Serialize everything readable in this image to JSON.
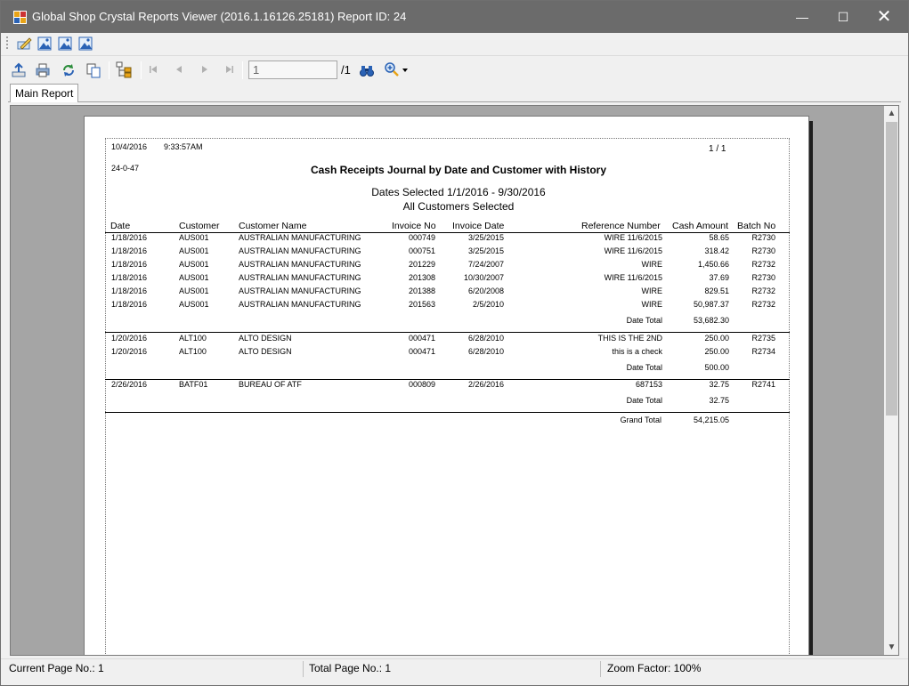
{
  "window": {
    "title": "Global Shop Crystal Reports Viewer (2016.1.16126.25181) Report ID: 24",
    "minimize": "—",
    "maximize": "☐",
    "close": "✕"
  },
  "toolbar": {
    "page_number": "1",
    "page_total": "/1"
  },
  "tabs": [
    {
      "label": "Main Report"
    }
  ],
  "report": {
    "print_date": "10/4/2016",
    "print_time": "9:33:57AM",
    "report_code": "24-0-47",
    "page_indicator": "1  /  1",
    "title": "Cash Receipts Journal by Date and Customer with History",
    "dates_selected": "Dates Selected   1/1/2016 - 9/30/2016",
    "customers_selected": "All Customers Selected",
    "columns": {
      "date": "Date",
      "customer": "Customer",
      "customer_name": "Customer Name",
      "invoice_no": "Invoice No",
      "invoice_date": "Invoice Date",
      "reference_number": "Reference Number",
      "cash_amount": "Cash Amount",
      "batch_no": "Batch No"
    },
    "groups": [
      {
        "rows": [
          {
            "date": "1/18/2016",
            "customer": "AUS001",
            "name": "AUSTRALIAN MANUFACTURING",
            "invoice": "000749",
            "inv_date": "3/25/2015",
            "ref": "WIRE 11/6/2015",
            "amount": "58.65",
            "batch": "R2730"
          },
          {
            "date": "1/18/2016",
            "customer": "AUS001",
            "name": "AUSTRALIAN MANUFACTURING",
            "invoice": "000751",
            "inv_date": "3/25/2015",
            "ref": "WIRE 11/6/2015",
            "amount": "318.42",
            "batch": "R2730"
          },
          {
            "date": "1/18/2016",
            "customer": "AUS001",
            "name": "AUSTRALIAN MANUFACTURING",
            "invoice": "201229",
            "inv_date": "7/24/2007",
            "ref": "WIRE",
            "amount": "1,450.66",
            "batch": "R2732"
          },
          {
            "date": "1/18/2016",
            "customer": "AUS001",
            "name": "AUSTRALIAN MANUFACTURING",
            "invoice": "201308",
            "inv_date": "10/30/2007",
            "ref": "WIRE 11/6/2015",
            "amount": "37.69",
            "batch": "R2730"
          },
          {
            "date": "1/18/2016",
            "customer": "AUS001",
            "name": "AUSTRALIAN MANUFACTURING",
            "invoice": "201388",
            "inv_date": "6/20/2008",
            "ref": "WIRE",
            "amount": "829.51",
            "batch": "R2732"
          },
          {
            "date": "1/18/2016",
            "customer": "AUS001",
            "name": "AUSTRALIAN MANUFACTURING",
            "invoice": "201563",
            "inv_date": "2/5/2010",
            "ref": "WIRE",
            "amount": "50,987.37",
            "batch": "R2732"
          }
        ],
        "total_label": "Date Total",
        "total": "53,682.30"
      },
      {
        "rows": [
          {
            "date": "1/20/2016",
            "customer": "ALT100",
            "name": "ALTO DESIGN",
            "invoice": "000471",
            "inv_date": "6/28/2010",
            "ref": "THIS IS THE 2ND",
            "amount": "250.00",
            "batch": "R2735"
          },
          {
            "date": "1/20/2016",
            "customer": "ALT100",
            "name": "ALTO DESIGN",
            "invoice": "000471",
            "inv_date": "6/28/2010",
            "ref": "this is a check",
            "amount": "250.00",
            "batch": "R2734"
          }
        ],
        "total_label": "Date Total",
        "total": "500.00"
      },
      {
        "rows": [
          {
            "date": "2/26/2016",
            "customer": "BATF01",
            "name": "BUREAU OF ATF",
            "invoice": "000809",
            "inv_date": "2/26/2016",
            "ref": "687153",
            "amount": "32.75",
            "batch": "R2741"
          }
        ],
        "total_label": "Date Total",
        "total": "32.75"
      }
    ],
    "grand_total_label": "Grand Total",
    "grand_total": "54,215.05"
  },
  "status": {
    "current_page": "Current Page No.: 1",
    "total_page": "Total Page No.: 1",
    "zoom": "Zoom Factor: 100%"
  }
}
